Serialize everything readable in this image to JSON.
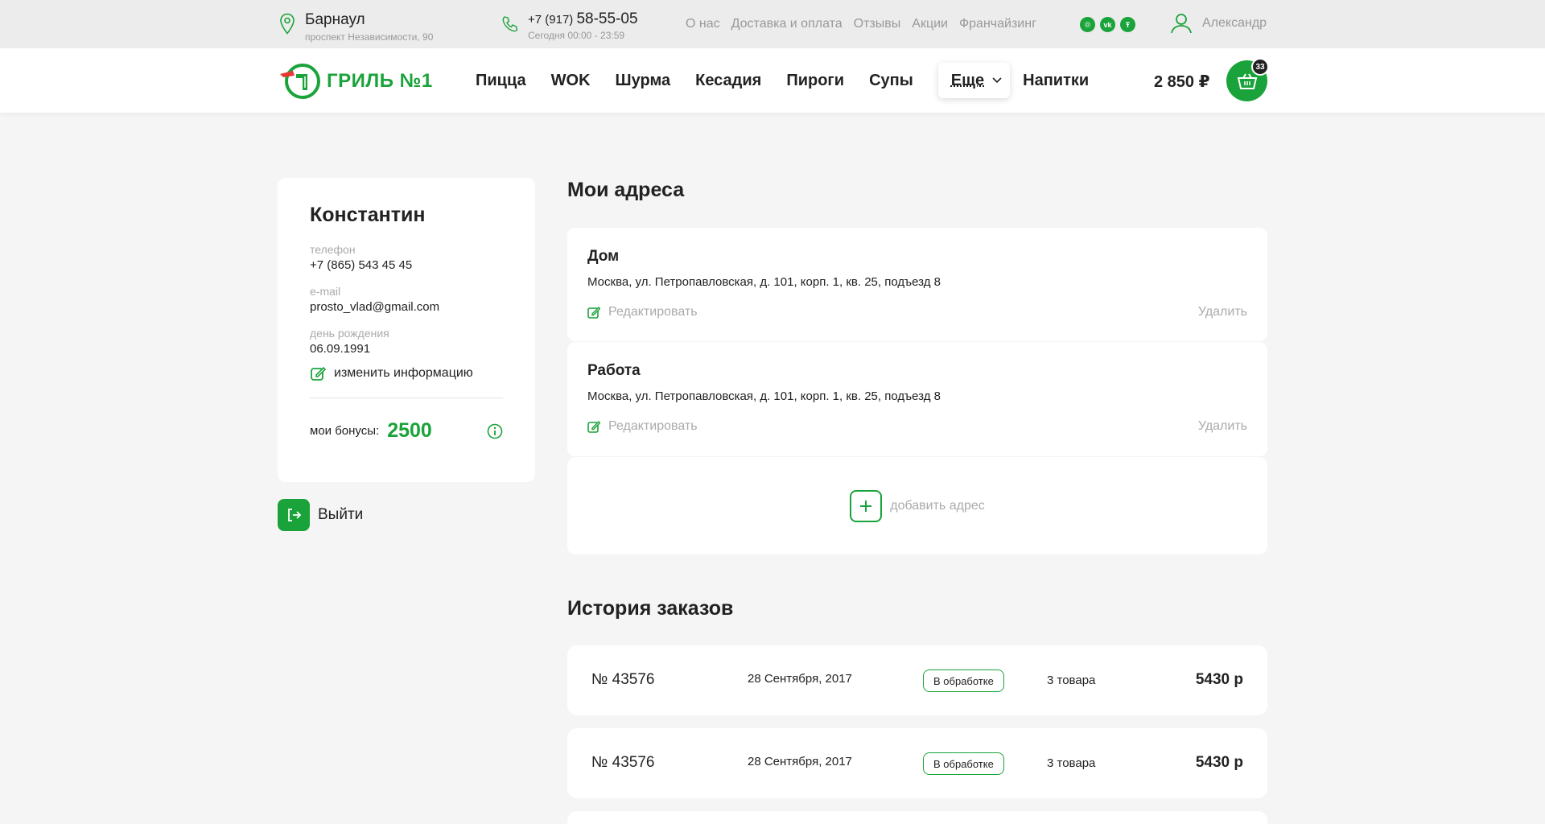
{
  "topbar": {
    "city": "Барнаул",
    "address": "проспект Независимости, 90",
    "phone_prefix": "+7 (917)",
    "phone_number": "58-55-05",
    "hours": "Сегодня 00:00 - 23:59",
    "links": [
      "О нас",
      "Доставка и оплата",
      "Отзывы",
      "Акции",
      "Франчайзинг"
    ],
    "socials": [
      "instagram-icon",
      "vk-icon",
      "tripadvisor-icon"
    ],
    "user_name": "Александр"
  },
  "nav": {
    "logo_text": "ГРИЛЬ №1",
    "items": [
      "Пицца",
      "WOK",
      "Шурма",
      "Кесадия",
      "Пироги",
      "Супы"
    ],
    "more_label": "Еще",
    "after_more": "Напитки",
    "cart_sum": "2 850 ₽",
    "cart_count": "33"
  },
  "profile": {
    "name": "Константин",
    "phone_label": "телефон",
    "phone": "+7 (865) 543 45 45",
    "email_label": "e-mail",
    "email": "prosto_vlad@gmail.com",
    "birthday_label": "день рождения",
    "birthday": "06.09.1991",
    "edit_label": "изменить информацию",
    "bonus_label": "мои бонусы:",
    "bonus_value": "2500",
    "logout_label": "Выйти"
  },
  "addresses": {
    "title": "Мои адреса",
    "items": [
      {
        "name": "Дом",
        "text": "Москва, ул. Петропавловская, д. 101, корп. 1, кв. 25, подъезд 8",
        "edit": "Редактировать",
        "delete": "Удалить"
      },
      {
        "name": "Работа",
        "text": "Москва, ул. Петропавловская, д. 101, корп. 1, кв. 25, подъезд 8",
        "edit": "Редактировать",
        "delete": "Удалить"
      }
    ],
    "add_label": "добавить адрес"
  },
  "orders": {
    "title": "История заказов",
    "rows": [
      {
        "number": "№ 43576",
        "date": "28 Сентября, 2017",
        "status": "В обработке",
        "items": "3 товара",
        "total": "5430 р"
      },
      {
        "number": "№ 43576",
        "date": "28 Сентября, 2017",
        "status": "В обработке",
        "items": "3 товара",
        "total": "5430 р"
      }
    ]
  },
  "colors": {
    "accent": "#1aa33a",
    "bg": "#f5f5f5",
    "muted": "#aaaaaa"
  }
}
